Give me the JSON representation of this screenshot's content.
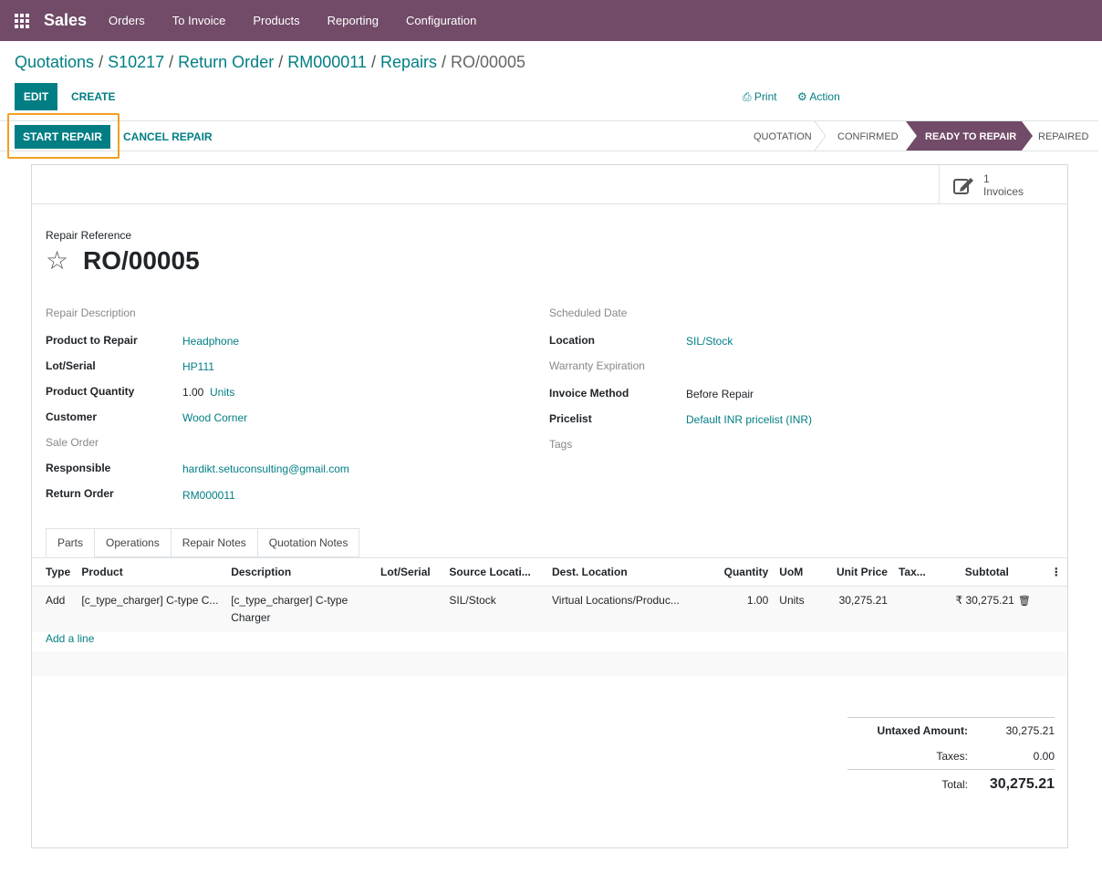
{
  "topbar": {
    "app_name": "Sales",
    "menu": [
      "Orders",
      "To Invoice",
      "Products",
      "Reporting",
      "Configuration"
    ]
  },
  "breadcrumb": {
    "items": [
      "Quotations",
      "S10217",
      "Return Order",
      "RM000011",
      "Repairs"
    ],
    "current": "RO/00005"
  },
  "controls": {
    "edit": "EDIT",
    "create": "CREATE",
    "print": "⎙ Print",
    "action": "⚙ Action"
  },
  "statusbar": {
    "start_repair": "START REPAIR",
    "cancel_repair": "CANCEL REPAIR",
    "stages": [
      "QUOTATION",
      "CONFIRMED",
      "READY TO REPAIR",
      "REPAIRED"
    ],
    "active_stage": "READY TO REPAIR"
  },
  "smart_button": {
    "count": "1",
    "label": "Invoices"
  },
  "record": {
    "ref_label": "Repair Reference",
    "ref": "RO/00005"
  },
  "left_fields": {
    "repair_description_label": "Repair Description",
    "product_label": "Product to Repair",
    "product_value": "Headphone",
    "lot_label": "Lot/Serial",
    "lot_value": "HP111",
    "qty_label": "Product Quantity",
    "qty_value": "1.00",
    "qty_uom": "Units",
    "customer_label": "Customer",
    "customer_value": "Wood Corner",
    "sale_order_label": "Sale Order",
    "responsible_label": "Responsible",
    "responsible_value": "hardikt.setuconsulting@gmail.com",
    "return_order_label": "Return Order",
    "return_order_value": "RM000011"
  },
  "right_fields": {
    "scheduled_label": "Scheduled Date",
    "location_label": "Location",
    "location_value": "SIL/Stock",
    "warranty_label": "Warranty Expiration",
    "invoice_method_label": "Invoice Method",
    "invoice_method_value": "Before Repair",
    "pricelist_label": "Pricelist",
    "pricelist_value": "Default INR pricelist (INR)",
    "tags_label": "Tags"
  },
  "tabs": [
    "Parts",
    "Operations",
    "Repair Notes",
    "Quotation Notes"
  ],
  "table": {
    "headers": [
      "Type",
      "Product",
      "Description",
      "Lot/Serial",
      "Source Locati...",
      "Dest. Location",
      "Quantity",
      "UoM",
      "Unit Price",
      "Tax...",
      "Subtotal"
    ],
    "row": {
      "type": "Add",
      "product": "[c_type_charger] C-type C...",
      "description": "[c_type_charger] C-type Charger",
      "lot": "",
      "source": "SIL/Stock",
      "dest": "Virtual Locations/Produc...",
      "quantity": "1.00",
      "uom": "Units",
      "unit_price": "30,275.21",
      "tax": "",
      "subtotal": "₹ 30,275.21"
    },
    "add_line": "Add a line"
  },
  "totals": {
    "untaxed_label": "Untaxed Amount:",
    "untaxed_value": "30,275.21",
    "taxes_label": "Taxes:",
    "taxes_value": "0.00",
    "total_label": "Total:",
    "total_value": "30,275.21"
  },
  "colors": {
    "brand": "#714b67",
    "accent": "#017e84",
    "highlight": "#f0a020"
  }
}
